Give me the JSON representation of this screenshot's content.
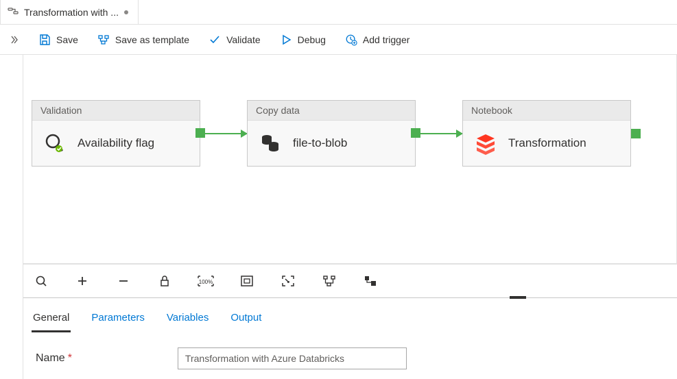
{
  "tab": {
    "title": "Transformation with ..."
  },
  "toolbar": {
    "save": "Save",
    "save_template": "Save as template",
    "validate": "Validate",
    "debug": "Debug",
    "add_trigger": "Add trigger"
  },
  "activities": {
    "validation": {
      "type": "Validation",
      "name": "Availability flag"
    },
    "copy": {
      "type": "Copy data",
      "name": "file-to-blob"
    },
    "notebook": {
      "type": "Notebook",
      "name": "Transformation"
    }
  },
  "props": {
    "tabs": {
      "general": "General",
      "parameters": "Parameters",
      "variables": "Variables",
      "output": "Output"
    },
    "name_label": "Name",
    "name_value": "Transformation with Azure Databricks"
  }
}
